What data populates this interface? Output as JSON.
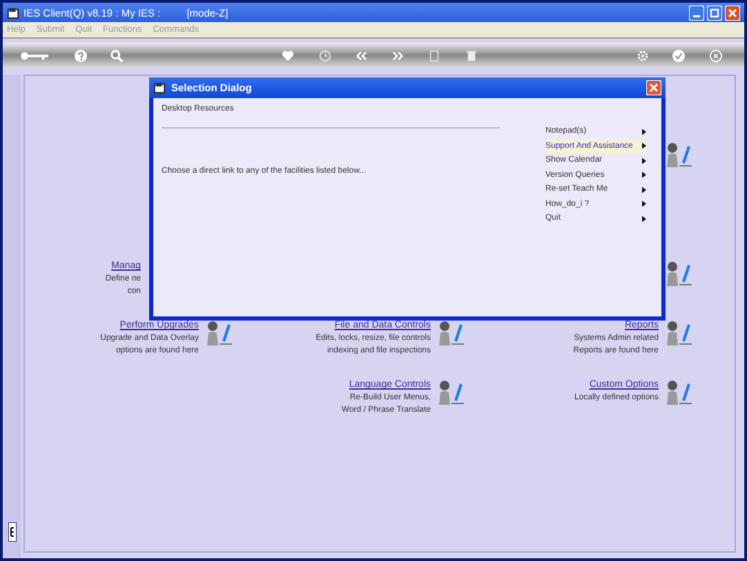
{
  "window": {
    "title": "IES Client(Q) v8.19 : My IES :",
    "mode": "[mode-Z]"
  },
  "menu": [
    "Help",
    "Submit",
    "Quit",
    "Functions",
    "Commands"
  ],
  "tile_rows": [
    {
      "cells": [
        {
          "kind": "covered"
        },
        {
          "kind": "covered"
        },
        {
          "kind": "icon_only"
        }
      ]
    },
    {
      "cells": [
        {
          "kind": "covered"
        },
        {
          "kind": "covered"
        },
        {
          "kind": "covered"
        }
      ]
    },
    {
      "cells": [
        {
          "kind": "clipped",
          "title": "Manag",
          "lines": [
            "Define ne",
            "con"
          ]
        },
        {
          "kind": "covered"
        },
        {
          "kind": "icon_only"
        }
      ]
    },
    {
      "cells": [
        {
          "kind": "link",
          "title": "Perform Upgrades",
          "lines": [
            "Upgrade and Data Overlay",
            "options are found here"
          ]
        },
        {
          "kind": "link",
          "title": "File and Data Controls",
          "lines": [
            "Edits, locks, resize, file controls",
            "indexing and file inspections"
          ]
        },
        {
          "kind": "link",
          "title": "Reports",
          "lines": [
            "Systems Admin related",
            "Reports are found here"
          ]
        }
      ]
    },
    {
      "cells": [
        {
          "kind": "covered"
        },
        {
          "kind": "link",
          "title": "Language Controls",
          "lines": [
            "Re-Build User Menus,",
            "Word / Phrase Translate"
          ]
        },
        {
          "kind": "link",
          "title": "Custom Options",
          "lines": [
            "Locally defined options"
          ]
        }
      ]
    }
  ],
  "dialog": {
    "title": "Selection Dialog",
    "section": "Desktop Resources",
    "prompt": "Choose a direct link to any of the facilities listed below...",
    "links": [
      {
        "label": "Notepad(s)",
        "selected": false
      },
      {
        "label": "Support And Assistance",
        "selected": true
      },
      {
        "label": "Show Calendar",
        "selected": false
      },
      {
        "label": "Version Queries",
        "selected": false
      },
      {
        "label": "Re-set Teach Me",
        "selected": false
      },
      {
        "label": "How_do_i ?",
        "selected": false
      },
      {
        "label": "Quit",
        "selected": false
      }
    ]
  }
}
